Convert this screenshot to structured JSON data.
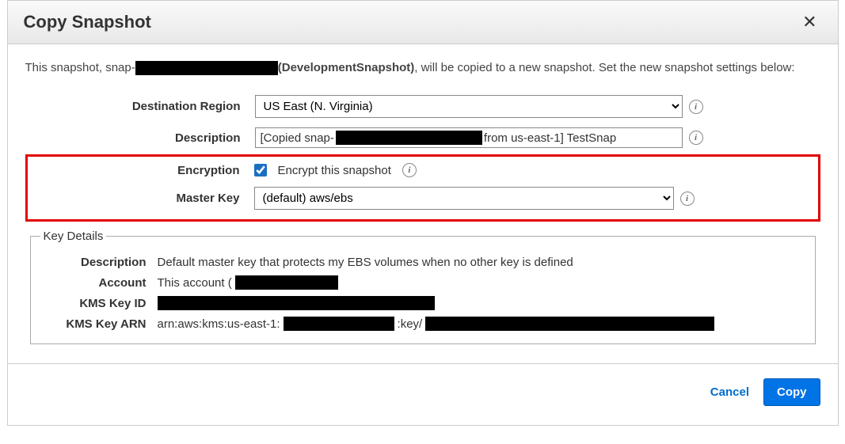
{
  "header": {
    "title": "Copy Snapshot"
  },
  "intro": {
    "pre": "This snapshot, snap-",
    "name": "(DevelopmentSnapshot)",
    "post": ", will be copied to a new snapshot. Set the new snapshot settings below:"
  },
  "form": {
    "destination_region_label": "Destination Region",
    "destination_region_value": "US East (N. Virginia)",
    "description_label": "Description",
    "description_pre": "[Copied snap-",
    "description_post": "from us-east-1] TestSnap",
    "encryption_label": "Encryption",
    "encrypt_checkbox_label": "Encrypt this snapshot",
    "master_key_label": "Master Key",
    "master_key_value": "(default) aws/ebs"
  },
  "key_details": {
    "legend": "Key Details",
    "description_label": "Description",
    "description_value": "Default master key that protects my EBS volumes when no other key is defined",
    "account_label": "Account",
    "account_value": "This account (",
    "kms_key_id_label": "KMS Key ID",
    "kms_key_arn_label": "KMS Key ARN",
    "kms_key_arn_pre": "arn:aws:kms:us-east-1:",
    "kms_key_arn_mid": ":key/"
  },
  "footer": {
    "cancel": "Cancel",
    "copy": "Copy"
  }
}
